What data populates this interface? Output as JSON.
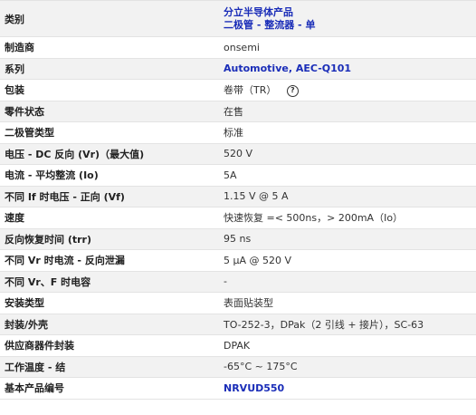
{
  "rows": [
    {
      "label": "类别",
      "value_lines": [
        "分立半导体产品",
        "二极管 - 整流器 - 单"
      ],
      "link": true
    },
    {
      "label": "制造商",
      "value": "onsemi",
      "link": false
    },
    {
      "label": "系列",
      "value": "Automotive, AEC-Q101",
      "link": true
    },
    {
      "label": "包装",
      "value": "卷带（TR）",
      "link": false,
      "help_icon": "?"
    },
    {
      "label": "零件状态",
      "value": "在售",
      "link": false
    },
    {
      "label": "二极管类型",
      "value": "标准",
      "link": false
    },
    {
      "label": "电压 - DC 反向 (Vr)（最大值)",
      "value": "520 V",
      "link": false
    },
    {
      "label": "电流 - 平均整流 (Io)",
      "value": "5A",
      "link": false
    },
    {
      "label": "不同 If 时电压 - 正向 (Vf)",
      "value": "1.15 V @ 5 A",
      "link": false
    },
    {
      "label": "速度",
      "value": "快速恢复 =< 500ns，> 200mA（Io）",
      "link": false
    },
    {
      "label": "反向恢复时间 (trr)",
      "value": "95 ns",
      "link": false
    },
    {
      "label": "不同 Vr 时电流 - 反向泄漏",
      "value": "5 µA @ 520 V",
      "link": false
    },
    {
      "label": "不同 Vr、F 时电容",
      "value": "-",
      "link": false
    },
    {
      "label": "安装类型",
      "value": "表面贴装型",
      "link": false
    },
    {
      "label": "封装/外壳",
      "value": "TO-252-3，DPak（2 引线 + 接片），SC-63",
      "link": false
    },
    {
      "label": "供应商器件封装",
      "value": "DPAK",
      "link": false
    },
    {
      "label": "工作温度 - 结",
      "value": "-65°C ~ 175°C",
      "link": false
    },
    {
      "label": "基本产品编号",
      "value": "NRVUD550",
      "link": true
    }
  ],
  "colors": {
    "link": "#1a2db8",
    "row_alt": "#f2f2f2",
    "border": "#e3e3e3"
  },
  "icons": {
    "help": "help-circle-icon"
  }
}
